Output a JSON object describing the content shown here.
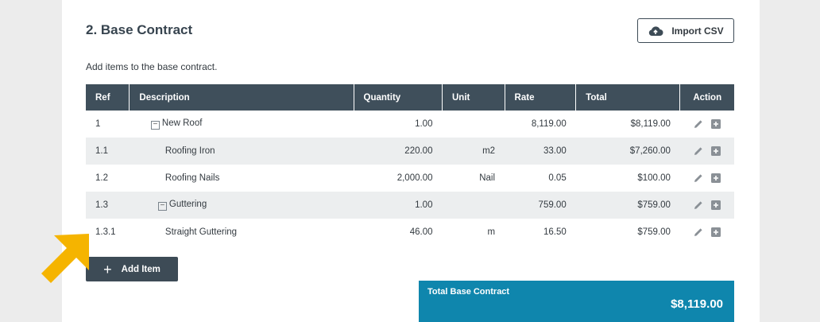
{
  "section": {
    "title": "2. Base Contract",
    "subtitle": "Add items to the base contract.",
    "import_label": "Import CSV",
    "import_icon": "cloud-upload-icon"
  },
  "table": {
    "headers": [
      "Ref",
      "Description",
      "Quantity",
      "Unit",
      "Rate",
      "Total",
      "Action"
    ],
    "rows": [
      {
        "ref": "1",
        "description": "New Roof",
        "quantity": "1.00",
        "unit": "",
        "rate": "8,119.00",
        "total": "$8,119.00"
      },
      {
        "ref": "1.1",
        "description": "Roofing Iron",
        "quantity": "220.00",
        "unit": "m2",
        "rate": "33.00",
        "total": "$7,260.00"
      },
      {
        "ref": "1.2",
        "description": "Roofing Nails",
        "quantity": "2,000.00",
        "unit": "Nail",
        "rate": "0.05",
        "total": "$100.00"
      },
      {
        "ref": "1.3",
        "description": "Guttering",
        "quantity": "1.00",
        "unit": "",
        "rate": "759.00",
        "total": "$759.00"
      },
      {
        "ref": "1.3.1",
        "description": "Straight Guttering",
        "quantity": "46.00",
        "unit": "m",
        "rate": "16.50",
        "total": "$759.00"
      }
    ]
  },
  "actions": {
    "add_item_label": "Add Item",
    "add_item_icon": "plus-icon"
  },
  "total": {
    "label": "Total Base Contract",
    "value": "$8,119.00"
  },
  "colors": {
    "header_bg": "#3f4f5b",
    "total_bg": "#0f86ad",
    "arrow": "#f5b400"
  }
}
